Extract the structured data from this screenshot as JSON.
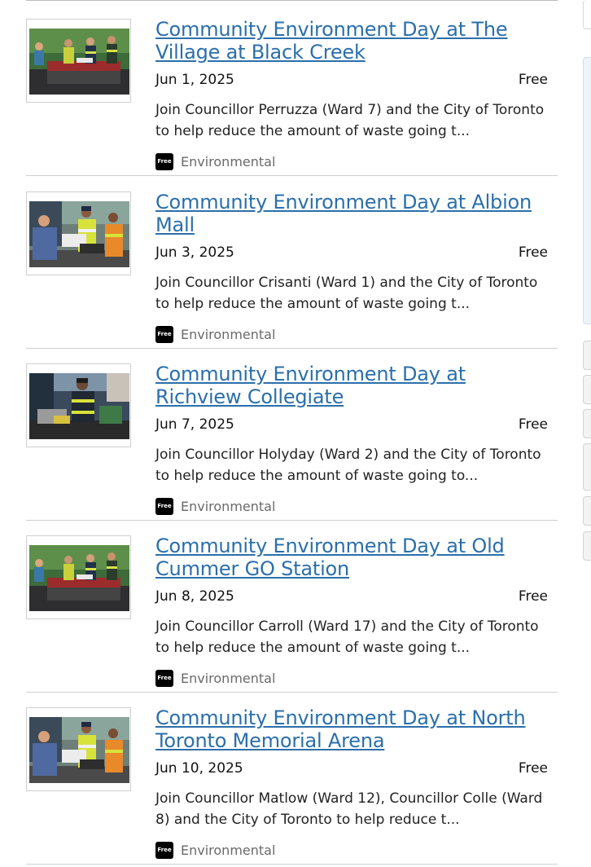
{
  "events": [
    {
      "title": "Community Environment Day at The Village at Black Creek",
      "date": "Jun 1, 2025",
      "price": "Free",
      "description": "Join Councillor Perruzza (Ward 7) and the City of Toronto to help reduce the amount of waste going t...",
      "badge": "Free",
      "category": "Environmental",
      "image": "volunteers-at-table-photo"
    },
    {
      "title": "Community Environment Day at Albion Mall",
      "date": "Jun 3, 2025",
      "price": "Free",
      "description": "Join Councillor Crisanti (Ward 1) and the City of Toronto to help reduce the amount of waste going t...",
      "badge": "Free",
      "category": "Environmental",
      "image": "handing-box-photo"
    },
    {
      "title": "Community Environment Day at Richview Collegiate",
      "date": "Jun 7, 2025",
      "price": "Free",
      "description": "Join Councillor Holyday (Ward 2) and the City of Toronto to help reduce the amount of waste going to...",
      "badge": "Free",
      "category": "Environmental",
      "image": "worker-sorting-photo"
    },
    {
      "title": "Community Environment Day at Old Cummer GO Station",
      "date": "Jun 8, 2025",
      "price": "Free",
      "description": "Join Councillor Carroll (Ward 17) and the City of Toronto to help reduce the amount of waste going t...",
      "badge": "Free",
      "category": "Environmental",
      "image": "volunteers-at-table-photo"
    },
    {
      "title": "Community Environment Day at North Toronto Memorial Arena",
      "date": "Jun 10, 2025",
      "price": "Free",
      "description": "Join Councillor Matlow (Ward 12), Councillor Colle (Ward 8) and the City of Toronto to help reduce t...",
      "badge": "Free",
      "category": "Environmental",
      "image": "handing-box-photo"
    }
  ]
}
